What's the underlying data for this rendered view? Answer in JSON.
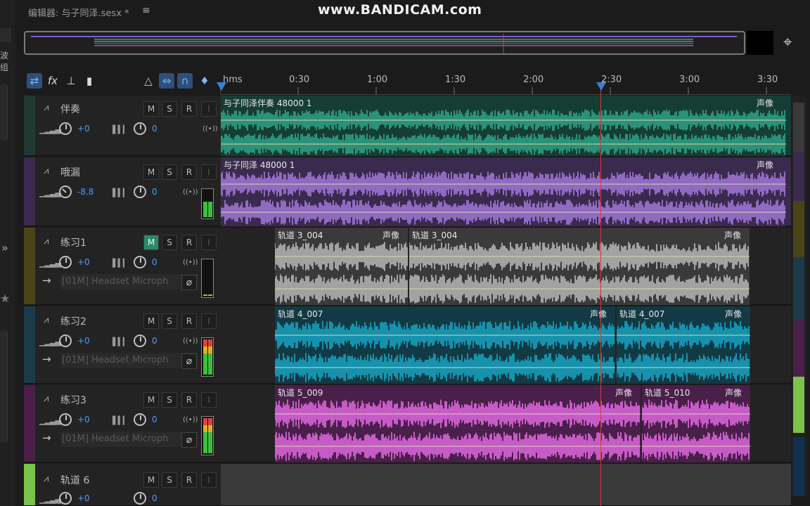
{
  "header": {
    "editor_title": "编辑器: 与子同泽.sesx *",
    "menu_icon": "menu-icon",
    "watermark": "www.BANDICAM.com"
  },
  "left_panel": {
    "partial_text": "波组"
  },
  "toolbar": {
    "left_tools": [
      "switch-icon",
      "fx-icon",
      "send-icon",
      "eq-icon"
    ],
    "right_tools": [
      "metronome-icon",
      "snap-icon",
      "magnet-icon",
      "marker-icon"
    ]
  },
  "ruler": {
    "labels": [
      "hms",
      "0:30",
      "1:00",
      "1:30",
      "2:00",
      "2:30",
      "3:00",
      "3:30"
    ],
    "max_seconds": 220
  },
  "playhead": {
    "time_seconds": 147
  },
  "tracks": [
    {
      "name": "伴奏",
      "color": "#1e3a33",
      "volume": "+0",
      "pan": "0",
      "clips": [
        {
          "name": "与子同泽伴奏 48000 1",
          "pan_label": "声像",
          "color": "#2fa88a",
          "bg": "#163d34"
        }
      ]
    },
    {
      "name": "哦漏",
      "color": "#3a2a4d",
      "volume": "-8.8",
      "pan": "0",
      "clips": [
        {
          "name": "与子同泽 48000 1",
          "pan_label": "声像",
          "color": "#a77ae0",
          "bg": "#3a2a4d"
        }
      ]
    },
    {
      "name": "练习1",
      "color": "#4a4518",
      "volume": "+0",
      "pan": "0",
      "input": "[01M] Headset Microph",
      "clips": [
        {
          "name": "轨道 3_004",
          "pan_label": "声像",
          "color": "#bdbdbd",
          "bg": "#3a3a3a"
        },
        {
          "name": "轨道 3_004",
          "pan_label": "声像",
          "color": "#bdbdbd",
          "bg": "#3a3a3a"
        }
      ]
    },
    {
      "name": "练习2",
      "color": "#1b3b4a",
      "volume": "+0",
      "pan": "0",
      "input": "[01M] Headset Microph",
      "clips": [
        {
          "name": "轨道 4_007",
          "pan_label": "声像",
          "color": "#17a8c8",
          "bg": "#123a44"
        },
        {
          "name": "轨道 4_007",
          "pan_label": "声像",
          "color": "#17a8c8",
          "bg": "#123a44"
        }
      ]
    },
    {
      "name": "练习3",
      "color": "#4a1f4a",
      "volume": "+0",
      "pan": "0",
      "input": "[01M] Headset Microph",
      "clips": [
        {
          "name": "轨道 5_009",
          "pan_label": "声像",
          "color": "#e56be5",
          "bg": "#4a1f4a"
        },
        {
          "name": "轨道 5_010",
          "pan_label": "声像",
          "color": "#e56be5",
          "bg": "#4a1f4a"
        }
      ]
    },
    {
      "name": "轨道 6",
      "color": "#7ac24a",
      "volume": "+0",
      "pan": "0"
    }
  ],
  "buttons": {
    "mute": "M",
    "solo": "S",
    "record": "R",
    "input": "I"
  }
}
